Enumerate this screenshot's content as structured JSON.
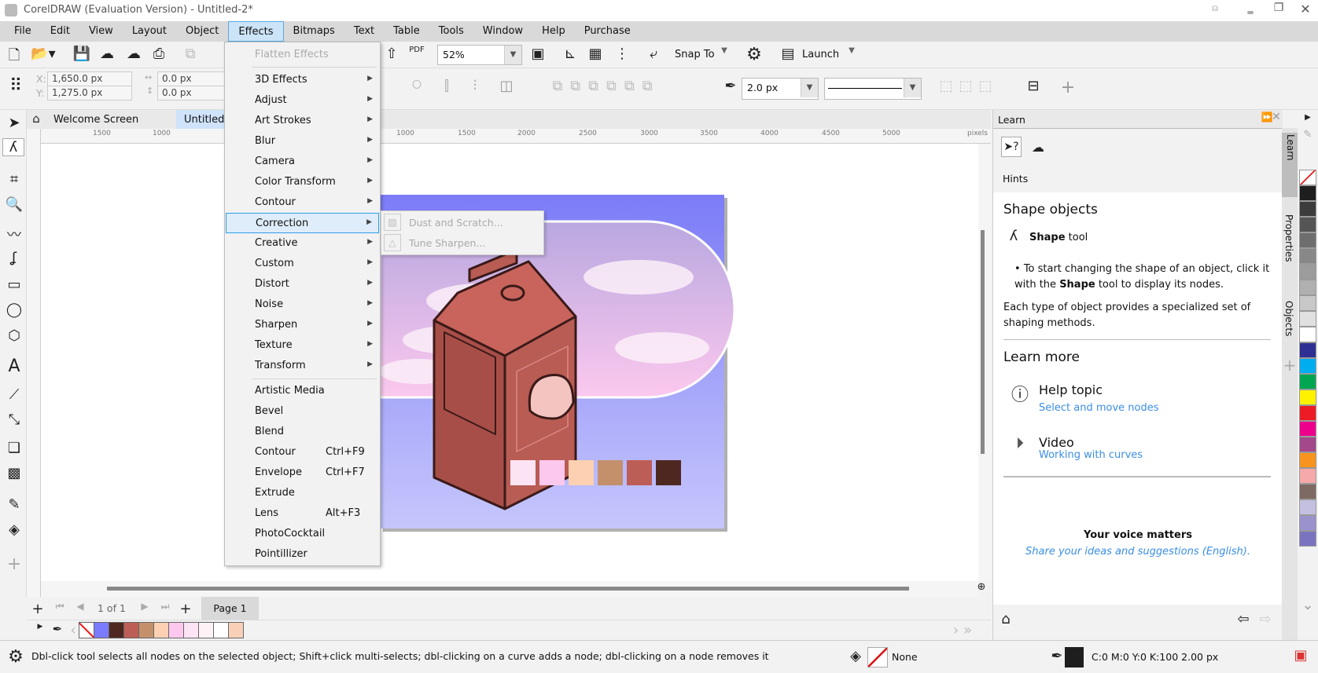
{
  "window": {
    "title": "CorelDRAW (Evaluation Version) - Untitled-2*"
  },
  "menubar": [
    "File",
    "Edit",
    "View",
    "Layout",
    "Object",
    "Effects",
    "Bitmaps",
    "Text",
    "Table",
    "Tools",
    "Window",
    "Help",
    "Purchase"
  ],
  "toolbar": {
    "zoom": "52%",
    "snap_to": "Snap To",
    "launch": "Launch"
  },
  "propbar": {
    "x": "1,650.0 px",
    "y": "1,275.0 px",
    "w": "0.0 px",
    "h": "0.0 px",
    "x_label": "X:",
    "y_label": "Y:",
    "outline_width": "2.0 px"
  },
  "tabs": {
    "welcome": "Welcome Screen",
    "doc": "Untitled-2*"
  },
  "ruler": {
    "ticks": [
      "1500",
      "1000",
      "1000",
      "1500",
      "2000",
      "2500",
      "3000",
      "3500",
      "4000",
      "4500",
      "5000"
    ],
    "unit": "pixels"
  },
  "effects_menu": {
    "flatten": "Flatten Effects",
    "submenus": [
      "3D Effects",
      "Adjust",
      "Art Strokes",
      "Blur",
      "Camera",
      "Color Transform",
      "Contour",
      "Correction",
      "Creative",
      "Custom",
      "Distort",
      "Noise",
      "Sharpen",
      "Texture",
      "Transform"
    ],
    "items": [
      {
        "label": "Artistic Media",
        "shortcut": ""
      },
      {
        "label": "Bevel",
        "shortcut": ""
      },
      {
        "label": "Blend",
        "shortcut": ""
      },
      {
        "label": "Contour",
        "shortcut": "Ctrl+F9"
      },
      {
        "label": "Envelope",
        "shortcut": "Ctrl+F7"
      },
      {
        "label": "Extrude",
        "shortcut": ""
      },
      {
        "label": "Lens",
        "shortcut": "Alt+F3"
      },
      {
        "label": "PhotoCocktail",
        "shortcut": ""
      },
      {
        "label": "Pointillizer",
        "shortcut": ""
      }
    ]
  },
  "correction_submenu": [
    "Dust and Scratch...",
    "Tune Sharpen..."
  ],
  "artwork": {
    "swatches": [
      "#fce4f4",
      "#fcc8ee",
      "#fcd0b0",
      "#c4906c",
      "#bc5e56",
      "#4e2820"
    ]
  },
  "pagenav": {
    "count": "1 of 1",
    "page_tab": "Page 1"
  },
  "doc_palette": [
    "#7b7bff",
    "#4e2820",
    "#bc5e56",
    "#c4906c",
    "#fdd0b4",
    "#fcc8ee",
    "#fce4f4",
    "#fdf2f6",
    "#ffffff",
    "#f8d0b8"
  ],
  "learn": {
    "title": "Learn",
    "hints": "Hints",
    "heading": "Shape objects",
    "tool_bold": "Shape",
    "tool_rest": " tool",
    "bullet_a": "To start changing the shape of an object, click it with the ",
    "bullet_bold": "Shape",
    "bullet_b": " tool to display its nodes.",
    "para": "Each type of object provides a specialized set of shaping methods.",
    "learn_more": "Learn more",
    "help_topic": "Help topic",
    "help_link": "Select and move nodes",
    "video": "Video",
    "video_link": "Working with curves",
    "voice_title": "Your voice matters",
    "voice_link": "Share your ideas and suggestions (English)."
  },
  "docker_tabs": [
    "Learn",
    "Properties",
    "Objects"
  ],
  "color_palette": [
    "#1e1e1e",
    "#3c3c3c",
    "#555555",
    "#6e6e6e",
    "#888888",
    "#9c9c9c",
    "#b0b0b0",
    "#c8c8c8",
    "#e0e0e0",
    "#ffffff",
    "#2e3192",
    "#00aeef",
    "#00a651",
    "#fff200",
    "#ed1c24",
    "#ec008c",
    "#a3488a",
    "#f7941d",
    "#f5a9a9",
    "#7d6a62",
    "#c4c0e0",
    "#9a92cc",
    "#7a74c0"
  ],
  "status": {
    "hint": "Dbl-click tool selects all nodes on the selected object; Shift+click multi-selects; dbl-clicking on a curve adds a node; dbl-clicking on a node removes it",
    "fill": "None",
    "outline": "C:0 M:0 Y:0 K:100  2.00 px"
  }
}
